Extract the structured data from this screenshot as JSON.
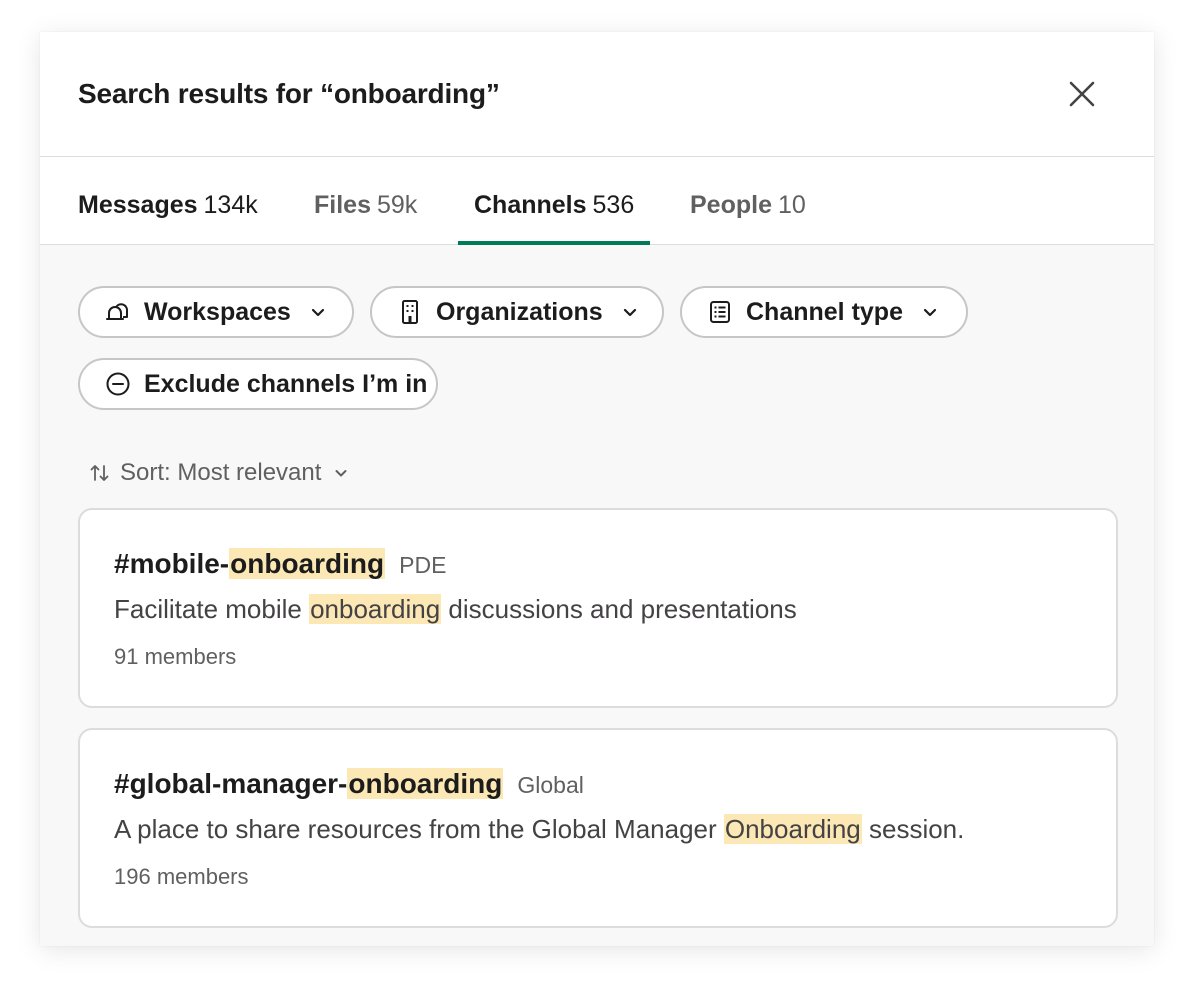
{
  "header": {
    "title": "Search results for “onboarding”"
  },
  "tabs": [
    {
      "label": "Messages",
      "count": "134k"
    },
    {
      "label": "Files",
      "count": "59k"
    },
    {
      "label": "Channels",
      "count": "536"
    },
    {
      "label": "People",
      "count": "10"
    }
  ],
  "active_tab": "Channels",
  "filters": {
    "workspaces": "Workspaces",
    "organizations": "Organizations",
    "channel_type": "Channel type",
    "exclude": "Exclude channels I’m in"
  },
  "sort": {
    "label": "Sort: Most relevant"
  },
  "results": [
    {
      "name_prefix": "#mobile-",
      "name_highlight": "onboarding",
      "workspace": "PDE",
      "desc_before": "Facilitate mobile ",
      "desc_highlight": "onboarding",
      "desc_after": " discussions and presentations",
      "members": "91 members"
    },
    {
      "name_prefix": "#global-manager-",
      "name_highlight": "onboarding",
      "workspace": "Global",
      "desc_before": "A place to share resources from the Global Manager ",
      "desc_highlight": "Onboarding",
      "desc_after": " session.",
      "members": "196 members"
    }
  ],
  "colors": {
    "accent": "#007a5a",
    "highlight": "#fbe8b5",
    "text_primary": "#1d1c1d",
    "text_secondary": "#616061"
  },
  "icons": {
    "close": "close-icon",
    "workspaces": "workspaces-icon",
    "organizations": "building-icon",
    "channel_type": "list-icon",
    "exclude": "minus-circle-icon",
    "sort": "sort-arrows-icon",
    "chevron": "chevron-down-icon"
  }
}
